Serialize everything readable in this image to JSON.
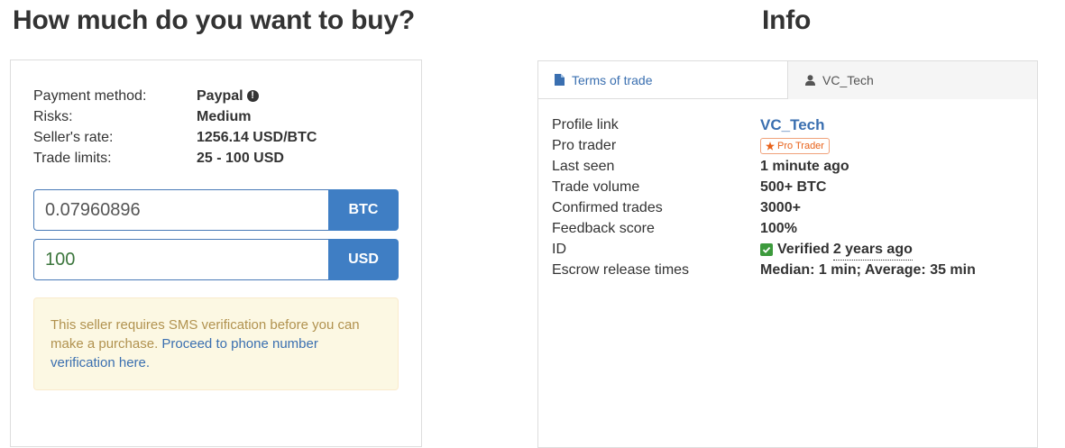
{
  "buy": {
    "title": "How much do you want to buy?",
    "details": [
      {
        "label": "Payment method:",
        "value": "Paypal",
        "has_info_icon": true
      },
      {
        "label": "Risks:",
        "value": "Medium"
      },
      {
        "label": "Seller's rate:",
        "value": "1256.14 USD/BTC"
      },
      {
        "label": "Trade limits:",
        "value": "25 - 100 USD"
      }
    ],
    "btc_amount": "0.07960896",
    "btc_unit": "BTC",
    "usd_amount": "100",
    "usd_unit": "USD",
    "alert_text": "This seller requires SMS verification before you can make a purchase.",
    "alert_link": "Proceed to phone number verification here."
  },
  "info": {
    "title": "Info",
    "tabs": [
      {
        "label": "Terms of trade",
        "icon": "document-icon",
        "active": false
      },
      {
        "label": "VC_Tech",
        "icon": "user-icon",
        "active": true
      }
    ],
    "rows": {
      "profile_link": {
        "label": "Profile link",
        "value": "VC_Tech"
      },
      "pro_trader": {
        "label": "Pro trader",
        "badge": "Pro Trader"
      },
      "last_seen": {
        "label": "Last seen",
        "value": "1 minute ago"
      },
      "trade_volume": {
        "label": "Trade volume",
        "value": "500+ BTC"
      },
      "confirmed_trades": {
        "label": "Confirmed trades",
        "value": "3000+"
      },
      "feedback_score": {
        "label": "Feedback score",
        "value": "100%"
      },
      "id": {
        "label": "ID",
        "verified": "Verified",
        "when": "2 years ago"
      },
      "escrow": {
        "label": "Escrow release times",
        "value": "Median: 1 min; Average: 35 min"
      }
    }
  },
  "colors": {
    "accent": "#3f7ec4",
    "link": "#3a6fb0",
    "alert_bg": "#fcf8e3",
    "alert_text": "#b1924f",
    "badge": "#e8621a",
    "verified": "#3c9a3c"
  }
}
